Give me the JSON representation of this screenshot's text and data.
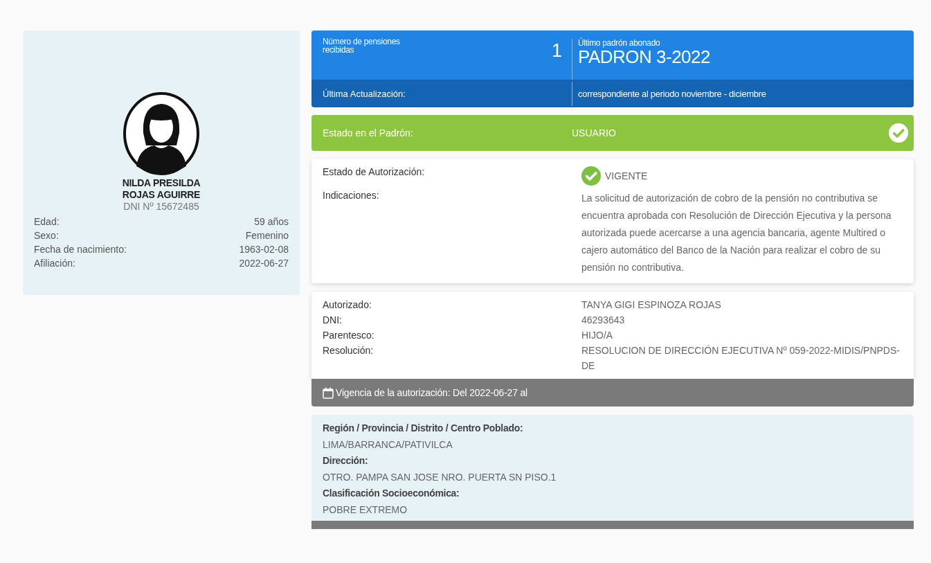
{
  "profile": {
    "name_lines": [
      "NILDA PRESILDA",
      "ROJAS AGUIRRE"
    ],
    "dni": "DNI Nº 15672485",
    "fields": [
      {
        "label": "Edad:",
        "value": "59 años"
      },
      {
        "label": "Sexo:",
        "value": "Femenino"
      },
      {
        "label": "Fecha de nacimiento:",
        "value": "1963-02-08"
      },
      {
        "label": "Afiliación:",
        "value": "2022-06-27"
      }
    ]
  },
  "summary": {
    "pensions_label": "Número de pensiones recibidas",
    "pensions_count": "1",
    "last_padron_label": "Último padrón abonado",
    "last_padron": "PADRON 3-2022",
    "update_label": "Última Actualización:",
    "update_value": "correspondiente al periodo noviembre - diciembre"
  },
  "padron_status": {
    "label": "Estado en el Padrón:",
    "value": "USUARIO"
  },
  "authorization": {
    "status_label": "Estado de Autorización:",
    "status_value": "VIGENTE",
    "indications_label": "Indicaciones:",
    "indications": "La solicitud de autorización de cobro de la pensión no contributiva se encuentra aprobada con Resolución de Dirección Ejecutiva y la persona autorizada puede acercarse a una agencia bancaria, agente Multired o cajero automático del Banco de la Nación para realizar el cobro de su pensión no contributiva."
  },
  "authorized": {
    "fields": [
      {
        "label": "Autorizado:",
        "value": "TANYA GIGI ESPINOZA ROJAS"
      },
      {
        "label": "DNI:",
        "value": "46293643"
      },
      {
        "label": "Parentesco:",
        "value": "HIJO/A"
      },
      {
        "label": "Resolución:",
        "value": "RESOLUCION DE DIRECCIÓN EJECUTIVA Nº 059-2022-MIDIS/PNPDS-DE"
      }
    ],
    "validity": "Vigencia de la autorización: Del 2022-06-27 al"
  },
  "location": {
    "fields": [
      {
        "label": "Región / Provincia / Distrito / Centro Poblado:",
        "value": "LIMA/BARRANCA/PATIVILCA"
      },
      {
        "label": "Dirección:",
        "value": "OTRO. PAMPA SAN JOSE NRO. PUERTA SN PISO.1"
      },
      {
        "label": "Clasificación Socioeconómica:",
        "value": "POBRE EXTREMO"
      }
    ]
  }
}
